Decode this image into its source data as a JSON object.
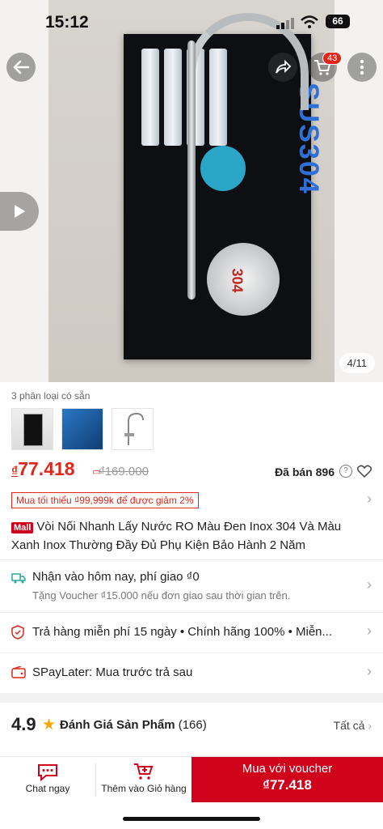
{
  "status_bar": {
    "time": "15:12",
    "battery": "66"
  },
  "gallery": {
    "brand_text": "SUS304",
    "plate_text": "304",
    "pager": "4/11"
  },
  "header": {
    "cart_badge": "43"
  },
  "variants": {
    "label": "3 phân loại có sẵn"
  },
  "pricing": {
    "currency": "₫",
    "price": "77.418",
    "old_price": "₫169.000",
    "sold": "Đã bán 896"
  },
  "promo": {
    "text": "Mua tối thiểu ₫99,999k để được giảm 2%"
  },
  "product": {
    "mall_tag": "Mall",
    "title": "Vòi Nối Nhanh Lấy Nước RO Màu Đen Inox 304 Và Màu Xanh Inox Thường Đầy Đủ Phụ Kiện Bảo Hành 2 Năm"
  },
  "shipping": {
    "main": "Nhận vào hôm nay, phí giao ₫0",
    "sub": "Tặng Voucher ₫15.000 nếu đơn giao sau thời gian trên."
  },
  "guarantee": {
    "main": "Trả hàng miễn phí 15 ngày  •  Chính hãng 100%  •  Miễn..."
  },
  "paylater": {
    "main": "SPayLater: Mua trước trả sau"
  },
  "rating": {
    "score": "4.9",
    "title": "Đánh Giá Sản Phẩm",
    "count": "(166)",
    "see_all": "Tất cả"
  },
  "bottom_bar": {
    "chat": "Chat ngay",
    "add_cart": "Thêm vào Giỏ hàng",
    "buy_label": "Mua với voucher",
    "buy_price": "₫77.418"
  },
  "colors": {
    "accent": "#d0011b",
    "price": "#e0261b"
  }
}
